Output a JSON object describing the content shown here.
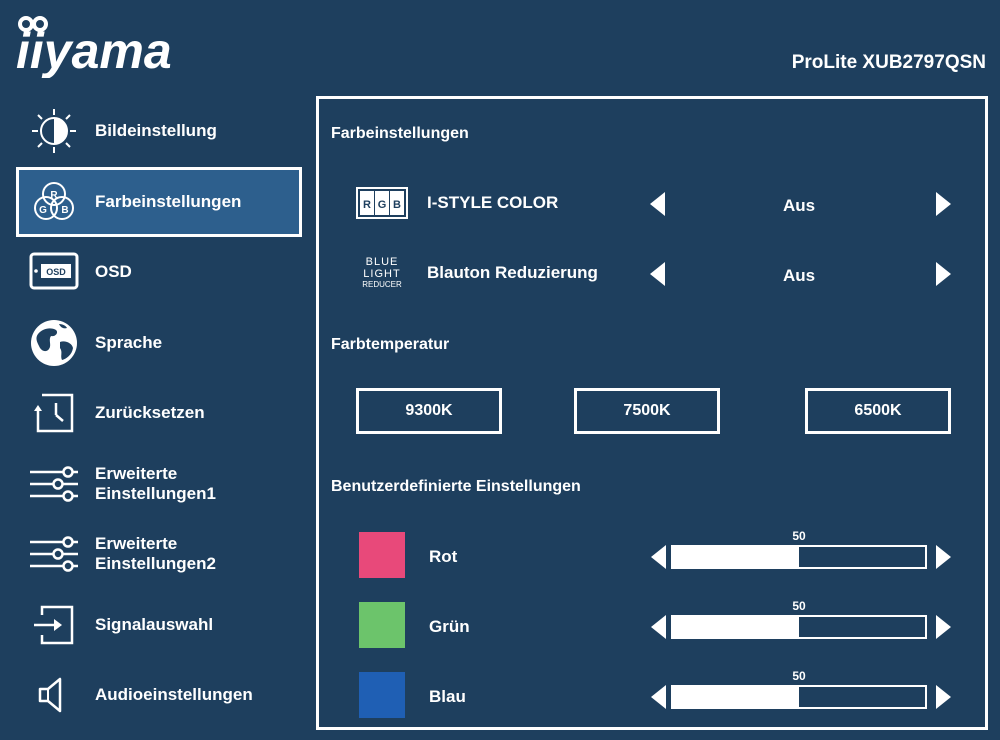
{
  "header": {
    "brand": "iiyama",
    "model": "ProLite XUB2797QSN"
  },
  "sidebar": {
    "items": [
      {
        "label": "Bildeinstellung",
        "icon": "brightness-icon",
        "active": false
      },
      {
        "label": "Farbeinstellungen",
        "icon": "rgb-color-icon",
        "active": true
      },
      {
        "label": "OSD",
        "icon": "osd-icon",
        "active": false
      },
      {
        "label": "Sprache",
        "icon": "globe-icon",
        "active": false
      },
      {
        "label": "Zurücksetzen",
        "icon": "reset-clock-icon",
        "active": false
      },
      {
        "label": "Erweiterte Einstellungen1",
        "icon": "sliders-icon",
        "active": false
      },
      {
        "label": "Erweiterte Einstellungen2",
        "icon": "sliders-icon",
        "active": false
      },
      {
        "label": "Signalauswahl",
        "icon": "input-source-icon",
        "active": false
      },
      {
        "label": "Audioeinstellungen",
        "icon": "speaker-icon",
        "active": false
      }
    ]
  },
  "panel": {
    "title": "Farbeinstellungen",
    "options": [
      {
        "label": "I-STYLE COLOR",
        "value": "Aus",
        "icon": "rgb-bars-icon",
        "icon_text": [
          "R",
          "G",
          "B"
        ]
      },
      {
        "label": "Blauton Reduzierung",
        "value": "Aus",
        "icon": "blue-light-reducer-icon",
        "icon_text": [
          "BLUE",
          "LIGHT",
          "REDUCER"
        ]
      }
    ],
    "temperature": {
      "title": "Farbtemperatur",
      "presets": [
        "9300K",
        "7500K",
        "6500K"
      ]
    },
    "custom": {
      "title": "Benutzerdefinierte Einstellungen",
      "max": 100,
      "channels": [
        {
          "label": "Rot",
          "value": 50,
          "color": "#e8497a"
        },
        {
          "label": "Grün",
          "value": 50,
          "color": "#6cc46b"
        },
        {
          "label": "Blau",
          "value": 50,
          "color": "#1f5fb4"
        }
      ]
    }
  }
}
